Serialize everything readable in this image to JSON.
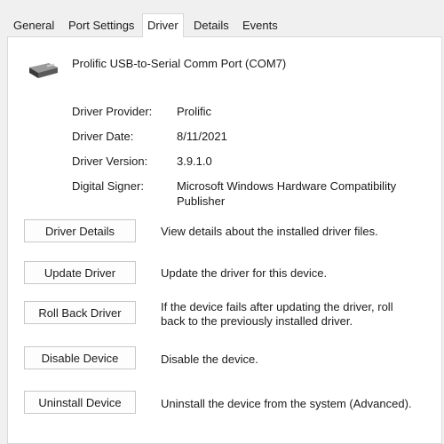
{
  "tabs": [
    "General",
    "Port Settings",
    "Driver",
    "Details",
    "Events"
  ],
  "active_tab": "Driver",
  "device": {
    "name": "Prolific USB-to-Serial Comm Port (COM7)",
    "icon": "serial-port-device-icon"
  },
  "properties": [
    {
      "label": "Driver Provider:",
      "value": "Prolific"
    },
    {
      "label": "Driver Date:",
      "value": "8/11/2021"
    },
    {
      "label": "Driver Version:",
      "value": "3.9.1.0"
    },
    {
      "label": "Digital Signer:",
      "value_line1": "Microsoft Windows Hardware Compatibility",
      "value_line2": "Publisher"
    }
  ],
  "actions": [
    {
      "button": "Driver Details",
      "description": "View details about the installed driver files."
    },
    {
      "button": "Update Driver",
      "description": "Update the driver for this device."
    },
    {
      "button": "Roll Back Driver",
      "description_line1": "If the device fails after updating the driver, roll",
      "description_line2": "back to the previously installed driver."
    },
    {
      "button": "Disable Device",
      "description": "Disable the device."
    },
    {
      "button": "Uninstall Device",
      "description": "Uninstall the device from the system (Advanced)."
    }
  ],
  "colors": {
    "window_bg": "#f0f0f0",
    "panel_bg": "#ffffff",
    "border": "#d9d9d9"
  }
}
